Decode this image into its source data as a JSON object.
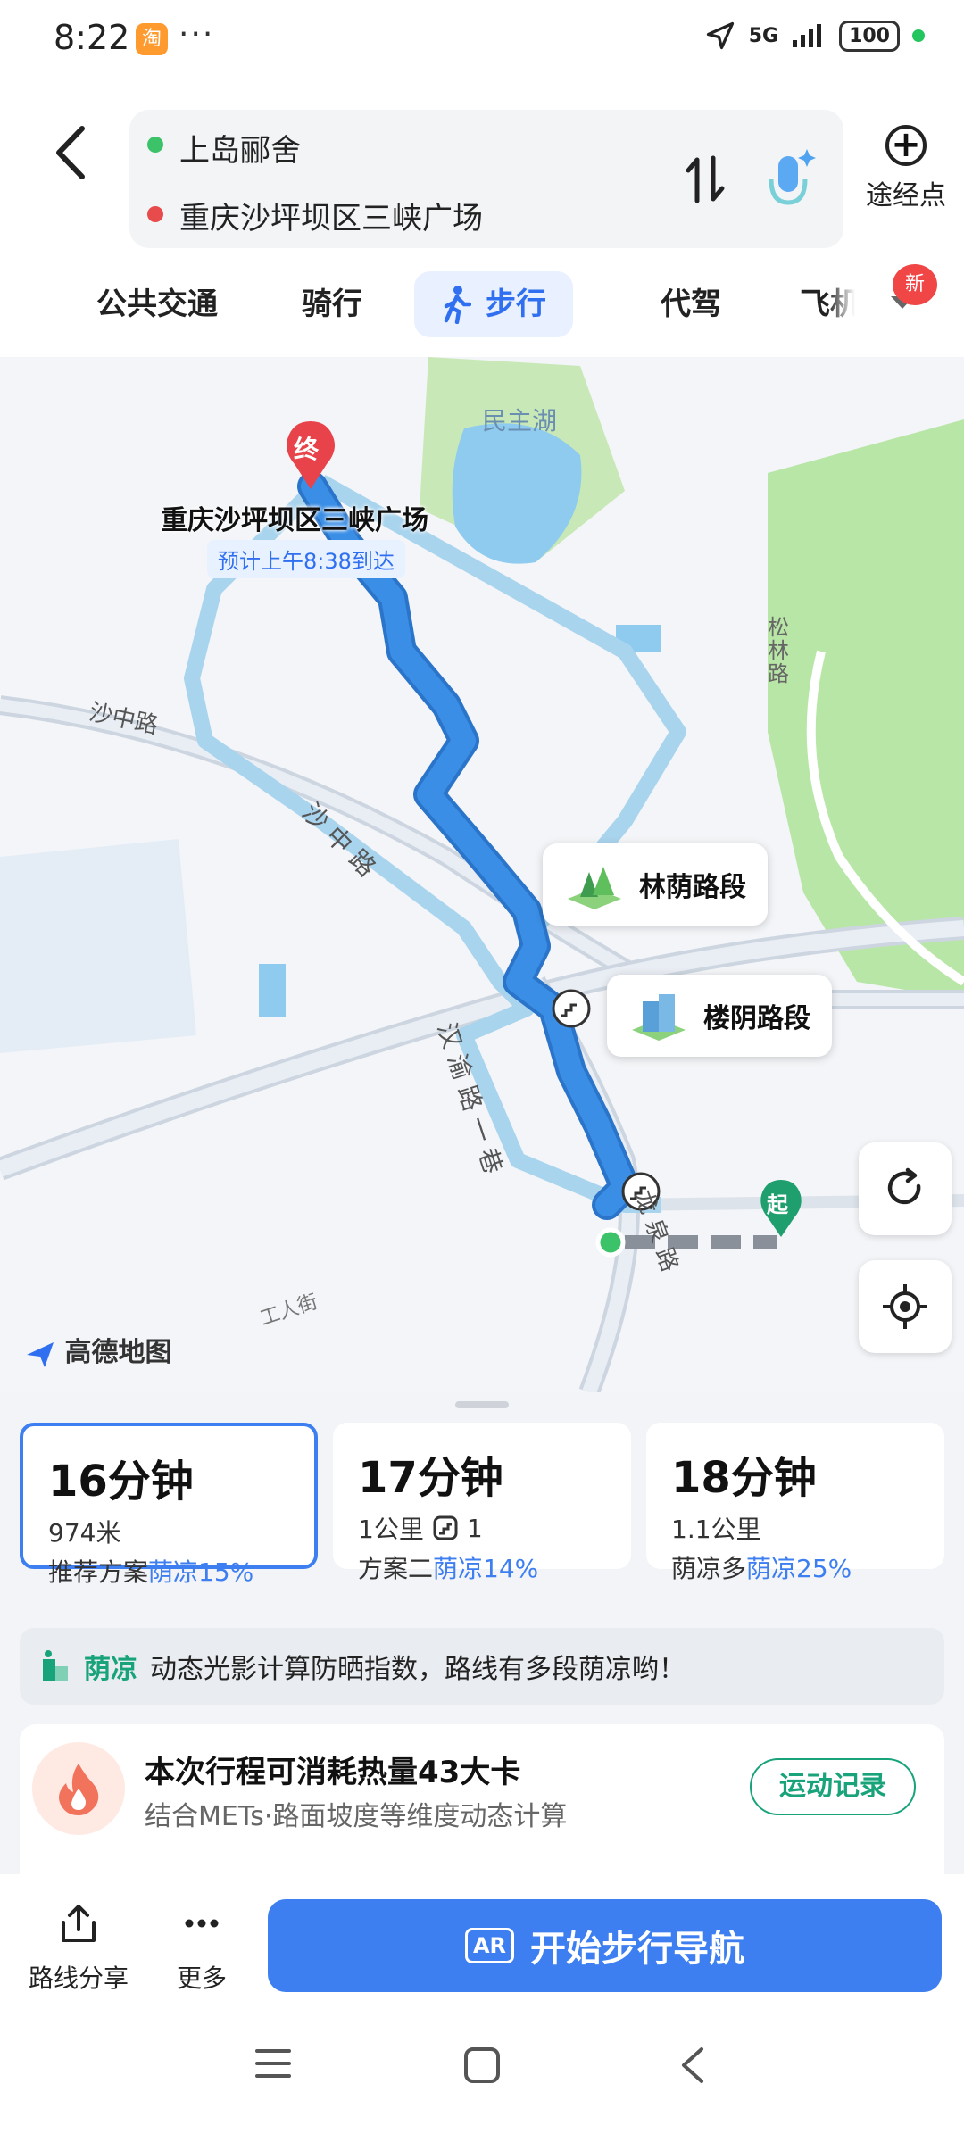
{
  "status_bar": {
    "time": "8:22",
    "dots": "···",
    "network": "5G",
    "battery": "100",
    "app_badge_icon": "taobao-icon"
  },
  "header": {
    "origin": "上岛郦舍",
    "destination": "重庆沙坪坝区三峡广场",
    "via_label": "途经点",
    "origin_color": "#3cc36a",
    "destination_color": "#e84b4b"
  },
  "tabs": {
    "items": [
      "公共交通",
      "骑行",
      "步行",
      "代驾",
      "飞机"
    ],
    "active": "步行",
    "new_badge": "新"
  },
  "map": {
    "lake_label": "民主湖",
    "road_shazhong_1": "沙中路",
    "road_shazhong_2": "沙 中 路",
    "road_hanyu": "汉 渝 路 一 巷",
    "road_songlin": "松 林 路",
    "road_longquan": "龙 泉 路",
    "road_gongren": "工人街",
    "dest_marker": "终",
    "start_marker": "起",
    "dest_name": "重庆沙坪坝区三峡广场",
    "dest_eta": "预计上午8:38到达",
    "callout_tree": "林荫路段",
    "callout_building": "楼阴路段",
    "watermark": "高德地图",
    "route_color": "#3a8ee6",
    "alt_route_color": "#a9d4ee"
  },
  "routes": [
    {
      "minutes": "16分钟",
      "distance": "974米",
      "label": "推荐方案",
      "shade": "荫凉15%",
      "selected": true
    },
    {
      "minutes": "17分钟",
      "distance": "1公里",
      "stairs": "1",
      "label": "方案二",
      "shade": "荫凉14%",
      "selected": false
    },
    {
      "minutes": "18分钟",
      "distance": "1.1公里",
      "label": "荫凉多",
      "shade": "荫凉25%",
      "selected": false
    }
  ],
  "tip": {
    "brand": "荫凉",
    "text": "动态光影计算防晒指数，路线有多段荫凉哟！"
  },
  "calorie": {
    "title": "本次行程可消耗热量43大卡",
    "desc": "结合METs·路面坡度等维度动态计算",
    "button": "运动记录"
  },
  "bottom": {
    "share": "路线分享",
    "more": "更多",
    "start": "开始步行导航",
    "ar_badge": "AR"
  }
}
